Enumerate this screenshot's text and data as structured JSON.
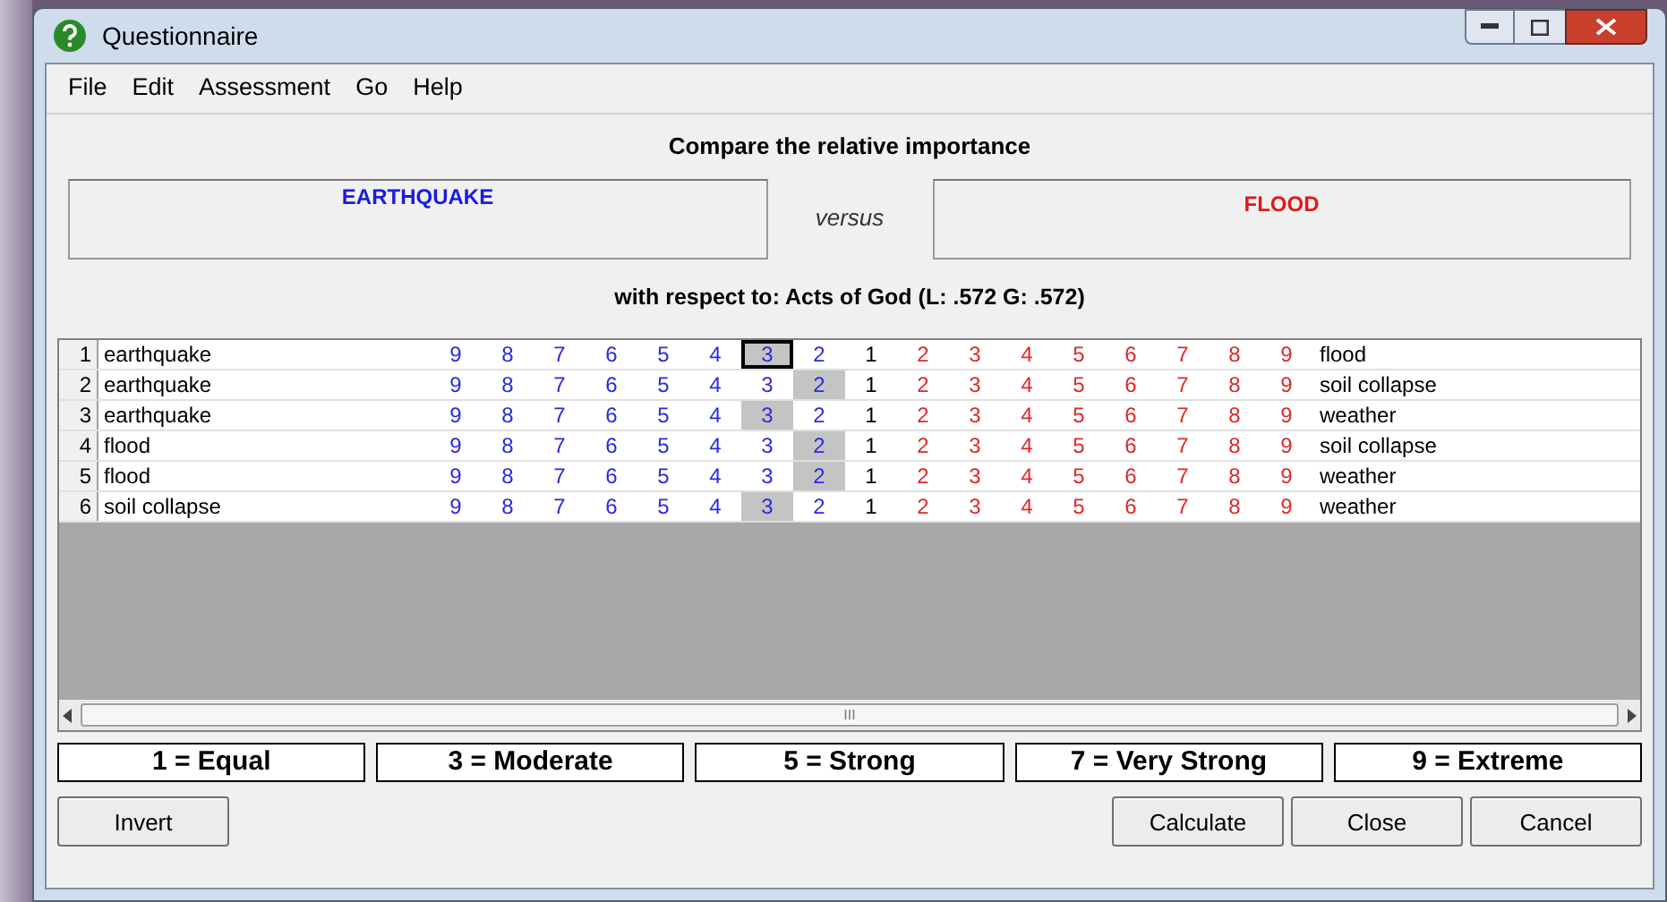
{
  "window": {
    "title": "Questionnaire"
  },
  "menu": [
    {
      "label": "File"
    },
    {
      "label": "Edit"
    },
    {
      "label": "Assessment"
    },
    {
      "label": "Go"
    },
    {
      "label": "Help"
    }
  ],
  "heading": "Compare the relative importance",
  "left_item": "EARTHQUAKE",
  "versus": "versus",
  "right_item": "FLOOD",
  "context": "with respect to: Acts of God (L: .572 G: .572)",
  "rows": [
    {
      "number": "1",
      "left": "earthquake",
      "right": "flood",
      "focused": true,
      "cells": [
        {
          "label": "9",
          "kind": "left",
          "selected": false
        },
        {
          "label": "8",
          "kind": "left",
          "selected": false
        },
        {
          "label": "7",
          "kind": "left",
          "selected": false
        },
        {
          "label": "6",
          "kind": "left",
          "selected": false
        },
        {
          "label": "5",
          "kind": "left",
          "selected": false
        },
        {
          "label": "4",
          "kind": "left",
          "selected": false
        },
        {
          "label": "3",
          "kind": "left",
          "selected": true
        },
        {
          "label": "2",
          "kind": "left",
          "selected": false
        },
        {
          "label": "1",
          "kind": "equal",
          "selected": false
        },
        {
          "label": "2",
          "kind": "right",
          "selected": false
        },
        {
          "label": "3",
          "kind": "right",
          "selected": false
        },
        {
          "label": "4",
          "kind": "right",
          "selected": false
        },
        {
          "label": "5",
          "kind": "right",
          "selected": false
        },
        {
          "label": "6",
          "kind": "right",
          "selected": false
        },
        {
          "label": "7",
          "kind": "right",
          "selected": false
        },
        {
          "label": "8",
          "kind": "right",
          "selected": false
        },
        {
          "label": "9",
          "kind": "right",
          "selected": false
        }
      ]
    },
    {
      "number": "2",
      "left": "earthquake",
      "right": "soil collapse",
      "focused": false,
      "cells": [
        {
          "label": "9",
          "kind": "left",
          "selected": false
        },
        {
          "label": "8",
          "kind": "left",
          "selected": false
        },
        {
          "label": "7",
          "kind": "left",
          "selected": false
        },
        {
          "label": "6",
          "kind": "left",
          "selected": false
        },
        {
          "label": "5",
          "kind": "left",
          "selected": false
        },
        {
          "label": "4",
          "kind": "left",
          "selected": false
        },
        {
          "label": "3",
          "kind": "left",
          "selected": false
        },
        {
          "label": "2",
          "kind": "left",
          "selected": true
        },
        {
          "label": "1",
          "kind": "equal",
          "selected": false
        },
        {
          "label": "2",
          "kind": "right",
          "selected": false
        },
        {
          "label": "3",
          "kind": "right",
          "selected": false
        },
        {
          "label": "4",
          "kind": "right",
          "selected": false
        },
        {
          "label": "5",
          "kind": "right",
          "selected": false
        },
        {
          "label": "6",
          "kind": "right",
          "selected": false
        },
        {
          "label": "7",
          "kind": "right",
          "selected": false
        },
        {
          "label": "8",
          "kind": "right",
          "selected": false
        },
        {
          "label": "9",
          "kind": "right",
          "selected": false
        }
      ]
    },
    {
      "number": "3",
      "left": "earthquake",
      "right": "weather",
      "focused": false,
      "cells": [
        {
          "label": "9",
          "kind": "left",
          "selected": false
        },
        {
          "label": "8",
          "kind": "left",
          "selected": false
        },
        {
          "label": "7",
          "kind": "left",
          "selected": false
        },
        {
          "label": "6",
          "kind": "left",
          "selected": false
        },
        {
          "label": "5",
          "kind": "left",
          "selected": false
        },
        {
          "label": "4",
          "kind": "left",
          "selected": false
        },
        {
          "label": "3",
          "kind": "left",
          "selected": true
        },
        {
          "label": "2",
          "kind": "left",
          "selected": false
        },
        {
          "label": "1",
          "kind": "equal",
          "selected": false
        },
        {
          "label": "2",
          "kind": "right",
          "selected": false
        },
        {
          "label": "3",
          "kind": "right",
          "selected": false
        },
        {
          "label": "4",
          "kind": "right",
          "selected": false
        },
        {
          "label": "5",
          "kind": "right",
          "selected": false
        },
        {
          "label": "6",
          "kind": "right",
          "selected": false
        },
        {
          "label": "7",
          "kind": "right",
          "selected": false
        },
        {
          "label": "8",
          "kind": "right",
          "selected": false
        },
        {
          "label": "9",
          "kind": "right",
          "selected": false
        }
      ]
    },
    {
      "number": "4",
      "left": "flood",
      "right": "soil collapse",
      "focused": false,
      "cells": [
        {
          "label": "9",
          "kind": "left",
          "selected": false
        },
        {
          "label": "8",
          "kind": "left",
          "selected": false
        },
        {
          "label": "7",
          "kind": "left",
          "selected": false
        },
        {
          "label": "6",
          "kind": "left",
          "selected": false
        },
        {
          "label": "5",
          "kind": "left",
          "selected": false
        },
        {
          "label": "4",
          "kind": "left",
          "selected": false
        },
        {
          "label": "3",
          "kind": "left",
          "selected": false
        },
        {
          "label": "2",
          "kind": "left",
          "selected": true
        },
        {
          "label": "1",
          "kind": "equal",
          "selected": false
        },
        {
          "label": "2",
          "kind": "right",
          "selected": false
        },
        {
          "label": "3",
          "kind": "right",
          "selected": false
        },
        {
          "label": "4",
          "kind": "right",
          "selected": false
        },
        {
          "label": "5",
          "kind": "right",
          "selected": false
        },
        {
          "label": "6",
          "kind": "right",
          "selected": false
        },
        {
          "label": "7",
          "kind": "right",
          "selected": false
        },
        {
          "label": "8",
          "kind": "right",
          "selected": false
        },
        {
          "label": "9",
          "kind": "right",
          "selected": false
        }
      ]
    },
    {
      "number": "5",
      "left": "flood",
      "right": "weather",
      "focused": false,
      "cells": [
        {
          "label": "9",
          "kind": "left",
          "selected": false
        },
        {
          "label": "8",
          "kind": "left",
          "selected": false
        },
        {
          "label": "7",
          "kind": "left",
          "selected": false
        },
        {
          "label": "6",
          "kind": "left",
          "selected": false
        },
        {
          "label": "5",
          "kind": "left",
          "selected": false
        },
        {
          "label": "4",
          "kind": "left",
          "selected": false
        },
        {
          "label": "3",
          "kind": "left",
          "selected": false
        },
        {
          "label": "2",
          "kind": "left",
          "selected": true
        },
        {
          "label": "1",
          "kind": "equal",
          "selected": false
        },
        {
          "label": "2",
          "kind": "right",
          "selected": false
        },
        {
          "label": "3",
          "kind": "right",
          "selected": false
        },
        {
          "label": "4",
          "kind": "right",
          "selected": false
        },
        {
          "label": "5",
          "kind": "right",
          "selected": false
        },
        {
          "label": "6",
          "kind": "right",
          "selected": false
        },
        {
          "label": "7",
          "kind": "right",
          "selected": false
        },
        {
          "label": "8",
          "kind": "right",
          "selected": false
        },
        {
          "label": "9",
          "kind": "right",
          "selected": false
        }
      ]
    },
    {
      "number": "6",
      "left": "soil collapse",
      "right": "weather",
      "focused": false,
      "cells": [
        {
          "label": "9",
          "kind": "left",
          "selected": false
        },
        {
          "label": "8",
          "kind": "left",
          "selected": false
        },
        {
          "label": "7",
          "kind": "left",
          "selected": false
        },
        {
          "label": "6",
          "kind": "left",
          "selected": false
        },
        {
          "label": "5",
          "kind": "left",
          "selected": false
        },
        {
          "label": "4",
          "kind": "left",
          "selected": false
        },
        {
          "label": "3",
          "kind": "left",
          "selected": true
        },
        {
          "label": "2",
          "kind": "left",
          "selected": false
        },
        {
          "label": "1",
          "kind": "equal",
          "selected": false
        },
        {
          "label": "2",
          "kind": "right",
          "selected": false
        },
        {
          "label": "3",
          "kind": "right",
          "selected": false
        },
        {
          "label": "4",
          "kind": "right",
          "selected": false
        },
        {
          "label": "5",
          "kind": "right",
          "selected": false
        },
        {
          "label": "6",
          "kind": "right",
          "selected": false
        },
        {
          "label": "7",
          "kind": "right",
          "selected": false
        },
        {
          "label": "8",
          "kind": "right",
          "selected": false
        },
        {
          "label": "9",
          "kind": "right",
          "selected": false
        }
      ]
    }
  ],
  "scrollbar_grip": "III",
  "legend": [
    "1 = Equal",
    "3 = Moderate",
    "5 = Strong",
    "7 = Very Strong",
    "9 = Extreme"
  ],
  "buttons_left": [
    "Invert"
  ],
  "buttons_right": [
    "Calculate",
    "Close",
    "Cancel"
  ]
}
